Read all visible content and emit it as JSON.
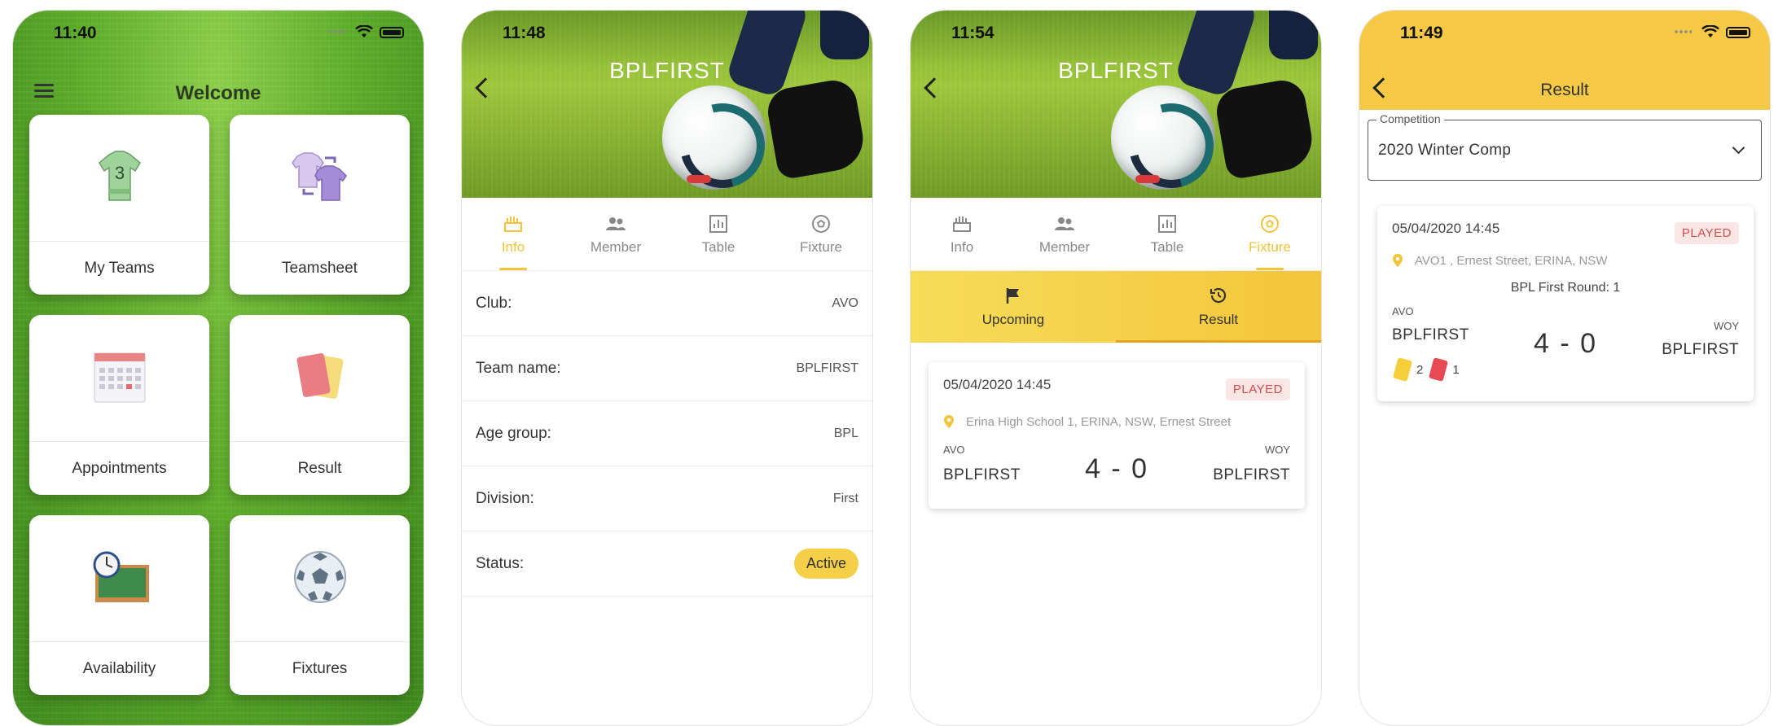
{
  "screens": {
    "home": {
      "time": "11:40",
      "title": "Welcome",
      "tiles": [
        {
          "label": "My Teams",
          "icon": "jersey-icon"
        },
        {
          "label": "Teamsheet",
          "icon": "swap-shirts-icon"
        },
        {
          "label": "Appointments",
          "icon": "calendar-icon"
        },
        {
          "label": "Result",
          "icon": "cards-icon"
        },
        {
          "label": "Availability",
          "icon": "clock-board-icon"
        },
        {
          "label": "Fixtures",
          "icon": "soccer-ball-icon"
        }
      ],
      "jersey_number": "3"
    },
    "team_info": {
      "time": "11:48",
      "title": "BPLFIRST",
      "tabs": [
        "Info",
        "Member",
        "Table",
        "Fixture"
      ],
      "active_tab": "Info",
      "rows": [
        {
          "key": "Club:",
          "value": "AVO"
        },
        {
          "key": "Team name:",
          "value": "BPLFIRST"
        },
        {
          "key": "Age group:",
          "value": "BPL"
        },
        {
          "key": "Division:",
          "value": "First"
        },
        {
          "key": "Status:",
          "value": "Active"
        }
      ]
    },
    "team_fixture": {
      "time": "11:54",
      "title": "BPLFIRST",
      "tabs": [
        "Info",
        "Member",
        "Table",
        "Fixture"
      ],
      "active_tab": "Fixture",
      "subtabs": [
        "Upcoming",
        "Result"
      ],
      "active_subtab": "Result",
      "match": {
        "date": "05/04/2020 14:45",
        "status": "PLAYED",
        "location": "Erina High School 1, ERINA, NSW, Ernest Street",
        "home_code": "AVO",
        "away_code": "WOY",
        "home_team": "BPLFIRST",
        "away_team": "BPLFIRST",
        "score": "4 - 0"
      }
    },
    "result": {
      "time": "11:49",
      "title": "Result",
      "competition_label": "Competition",
      "competition_value": "2020 Winter Comp",
      "match": {
        "date": "05/04/2020 14:45",
        "status": "PLAYED",
        "location": "AVO1 , Ernest Street, ERINA, NSW",
        "round": "BPL First Round: 1",
        "home_code": "AVO",
        "away_code": "WOY",
        "home_team": "BPLFIRST",
        "away_team": "BPLFIRST",
        "score": "4 - 0",
        "yellow_cards": "2",
        "red_cards": "1"
      }
    }
  },
  "colors": {
    "accent_yellow": "#f5c945",
    "played_red": "#d64b4b",
    "grass_green": "#5fae2c"
  }
}
